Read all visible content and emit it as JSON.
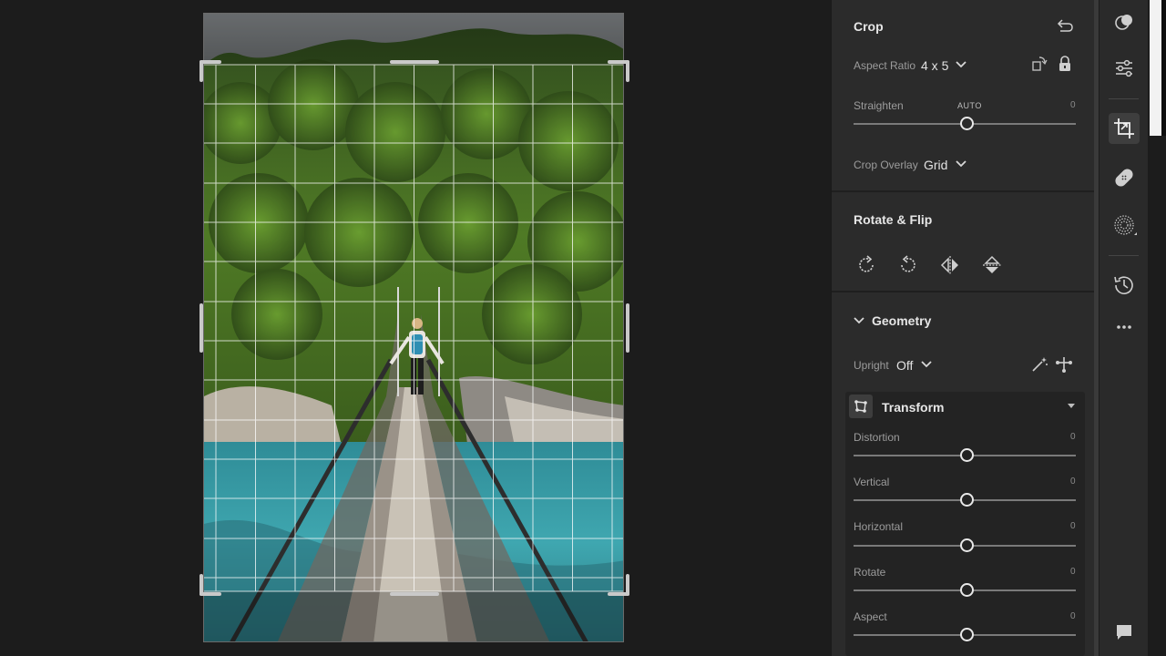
{
  "crop": {
    "title": "Crop",
    "aspect_label": "Aspect Ratio",
    "aspect_value": "4 x 5",
    "straighten_label": "Straighten",
    "straighten_auto": "AUTO",
    "straighten_value": "0",
    "overlay_label": "Crop Overlay",
    "overlay_value": "Grid"
  },
  "rotate": {
    "title": "Rotate & Flip"
  },
  "geometry": {
    "title": "Geometry",
    "upright_label": "Upright",
    "upright_value": "Off",
    "transform_title": "Transform",
    "sliders": [
      {
        "label": "Distortion",
        "value": "0"
      },
      {
        "label": "Vertical",
        "value": "0"
      },
      {
        "label": "Horizontal",
        "value": "0"
      },
      {
        "label": "Rotate",
        "value": "0"
      },
      {
        "label": "Aspect",
        "value": "0"
      }
    ]
  },
  "colors": {
    "accent": "#e8e8e8",
    "panel": "#2b2b2b",
    "background": "#1c1c1c"
  },
  "tools": [
    "presets-icon",
    "edit-icon",
    "crop-icon",
    "healing-icon",
    "masking-icon",
    "history-icon",
    "more-icon",
    "comment-icon"
  ]
}
